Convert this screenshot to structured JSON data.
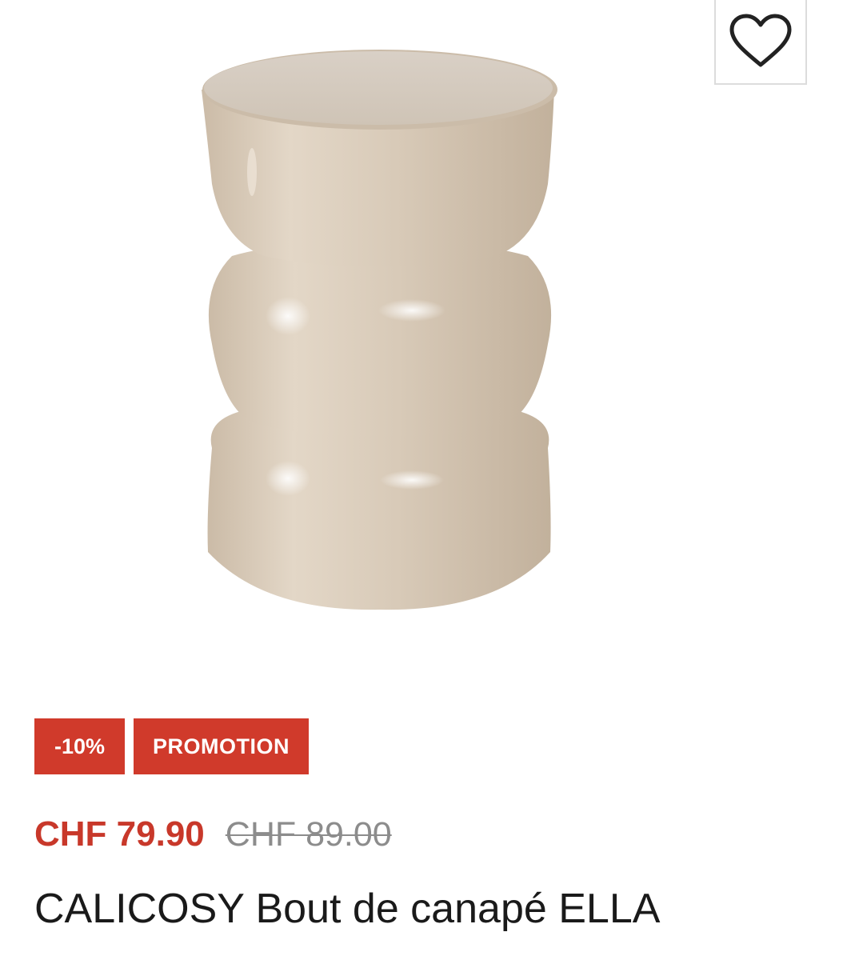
{
  "product": {
    "image_alt": "CALICOSY Bout de canapé ELLA",
    "badges": {
      "discount": "-10%",
      "promotion": "PROMOTION"
    },
    "price": {
      "current": "CHF 79.90",
      "original": "CHF 89.00"
    },
    "title": "CALICOSY Bout de canapé ELLA"
  },
  "icons": {
    "wishlist": "heart-icon"
  },
  "colors": {
    "accent_red": "#d03a2b",
    "price_red": "#c8382a",
    "old_price_grey": "#8c8c8c",
    "product_beige": "#d6c9b8"
  }
}
